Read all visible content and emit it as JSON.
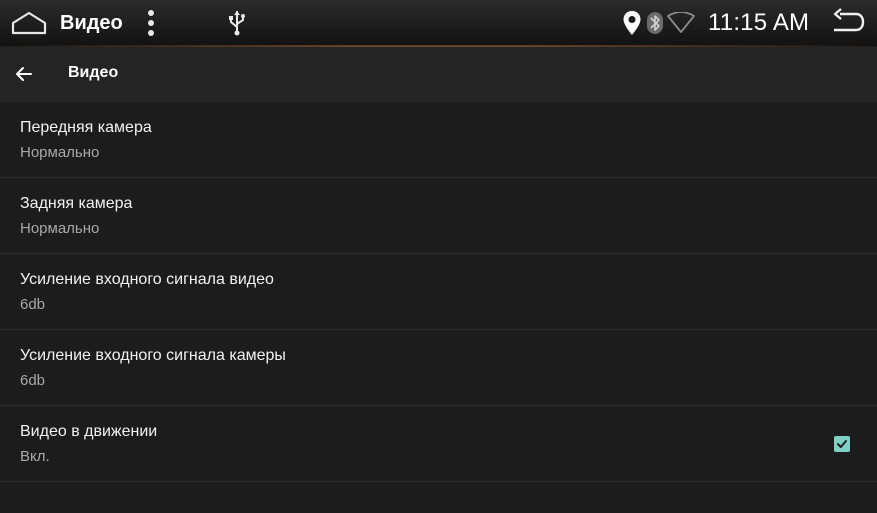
{
  "status_bar": {
    "app_title": "Видео",
    "time": "11:15 AM",
    "icons": {
      "home": "home-icon",
      "menu": "more-vertical-icon",
      "usb": "usb-icon",
      "location": "location-pin-icon",
      "bluetooth": "bluetooth-icon",
      "wifi": "wifi-icon",
      "back": "back-arrow-icon"
    }
  },
  "toolbar": {
    "title": "Видео",
    "back_icon": "arrow-left-icon"
  },
  "settings": [
    {
      "title": "Передняя камера",
      "summary": "Нормально"
    },
    {
      "title": "Задняя камера",
      "summary": "Нормально"
    },
    {
      "title": "Усиление входного сигнала видео",
      "summary": "6db"
    },
    {
      "title": "Усиление входного сигнала камеры",
      "summary": "6db"
    },
    {
      "title": "Видео в движении",
      "summary": "Вкл.",
      "checked": true
    }
  ],
  "colors": {
    "background": "#1c1c1c",
    "toolbar": "#242424",
    "accent": "#7fcfc4",
    "summary_text": "#a8a8a8"
  }
}
